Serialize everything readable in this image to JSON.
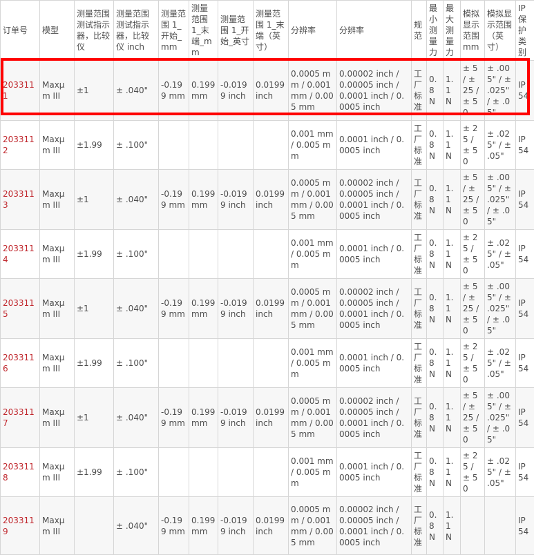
{
  "headers": [
    "订单号",
    "模型",
    "测量范围测试指示器，比较仪",
    "测量范围测试指示器，比较仪 inch",
    "测量范围 1_开始_mm",
    "测量范围 1_末端_mm",
    "测量范围 1_开始_英寸",
    "测量范围 1_末端（英寸）",
    "分辨率",
    "分辨率",
    "规范",
    "最小测量力",
    "最大测量力",
    "模拟显示范围 mm",
    "模拟显示范围（英寸）",
    "IP 保护类别"
  ],
  "rows": [
    {
      "order": "2033111",
      "model": "Maxμm III",
      "range": "±1",
      "range_inch": "± .040\"",
      "start_mm": "-0.199 mm",
      "end_mm": "0.199 mm",
      "start_in": "-0.0199 inch",
      "end_in": "0.0199 inch",
      "res_mm": "0.0005 mm / 0.001 mm / 0.005 mm",
      "res_in": "0.00002 inch / 0.00005 inch / 0.0001 inch / 0.0005 inch",
      "spec": "工厂标准",
      "min_force": "0.8 N",
      "max_force": "1.1 N",
      "analog_mm": "± 5 / ± 25 / ± 50",
      "analog_in": "± .005\" / ± .025\" / ± .05\"",
      "ip": "IP 54"
    },
    {
      "order": "2033112",
      "model": "Maxμm III",
      "range": "±1.99",
      "range_inch": "± .100\"",
      "start_mm": "",
      "end_mm": "",
      "start_in": "",
      "end_in": "",
      "res_mm": "0.001 mm / 0.005 mm",
      "res_in": "0.0001 inch / 0.0005 inch",
      "spec": "工厂标准",
      "min_force": "0.8 N",
      "max_force": "1.1 N",
      "analog_mm": "± 25 / ± 50",
      "analog_in": "± .025\" / ± .05\"",
      "ip": "IP 54"
    },
    {
      "order": "2033113",
      "model": "Maxμm III",
      "range": "±1",
      "range_inch": "± .040\"",
      "start_mm": "-0.199 mm",
      "end_mm": "0.199 mm",
      "start_in": "-0.0199 inch",
      "end_in": "0.0199 inch",
      "res_mm": "0.0005 mm / 0.001 mm / 0.005 mm",
      "res_in": "0.00002 inch / 0.00005 inch / 0.0001 inch / 0.0005 inch",
      "spec": "工厂标准",
      "min_force": "0.8 N",
      "max_force": "1.1 N",
      "analog_mm": "± 5 / ± 25 / ± 50",
      "analog_in": "± .005\" / ± .025\" / ± .05\"",
      "ip": "IP 54"
    },
    {
      "order": "2033114",
      "model": "Maxμm III",
      "range": "±1.99",
      "range_inch": "± .100\"",
      "start_mm": "",
      "end_mm": "",
      "start_in": "",
      "end_in": "",
      "res_mm": "0.001 mm / 0.005 mm",
      "res_in": "0.0001 inch / 0.0005 inch",
      "spec": "工厂标准",
      "min_force": "0.8 N",
      "max_force": "1.1 N",
      "analog_mm": "± 25 / ± 50",
      "analog_in": "± .025\" / ± .05\"",
      "ip": "IP 54"
    },
    {
      "order": "2033115",
      "model": "Maxμm III",
      "range": "±1",
      "range_inch": "± .040\"",
      "start_mm": "-0.199 mm",
      "end_mm": "0.199 mm",
      "start_in": "-0.0199 inch",
      "end_in": "0.0199 inch",
      "res_mm": "0.0005 mm / 0.001 mm / 0.005 mm",
      "res_in": "0.00002 inch / 0.00005 inch / 0.0001 inch / 0.0005 inch",
      "spec": "工厂标准",
      "min_force": "0.8 N",
      "max_force": "1.1 N",
      "analog_mm": "± 5 / ± 25 / ± 50",
      "analog_in": "± .005\" / ± .025\" / ± .05\"",
      "ip": "IP 54"
    },
    {
      "order": "2033116",
      "model": "Maxμm III",
      "range": "±1.99",
      "range_inch": "± .100\"",
      "start_mm": "",
      "end_mm": "",
      "start_in": "",
      "end_in": "",
      "res_mm": "0.001 mm / 0.005 mm",
      "res_in": "0.0001 inch / 0.0005 inch",
      "spec": "工厂标准",
      "min_force": "0.8 N",
      "max_force": "1.1 N",
      "analog_mm": "± 25 / ± 50",
      "analog_in": "± .025\" / ± .05\"",
      "ip": "IP 54"
    },
    {
      "order": "2033117",
      "model": "Maxμm III",
      "range": "±1",
      "range_inch": "± .040\"",
      "start_mm": "-0.199 mm",
      "end_mm": "0.199 mm",
      "start_in": "-0.0199 inch",
      "end_in": "0.0199 inch",
      "res_mm": "0.0005 mm / 0.001 mm / 0.005 mm",
      "res_in": "0.00002 inch / 0.00005 inch / 0.0001 inch / 0.0005 inch",
      "spec": "工厂标准",
      "min_force": "0.8 N",
      "max_force": "1.1 N",
      "analog_mm": "± 5 / ± 25 / ± 50",
      "analog_in": "± .005\" / ± .025\" / ± .05\"",
      "ip": "IP 54"
    },
    {
      "order": "2033118",
      "model": "Maxμm III",
      "range": "±1.99",
      "range_inch": "± .100\"",
      "start_mm": "",
      "end_mm": "",
      "start_in": "",
      "end_in": "",
      "res_mm": "0.001 mm / 0.005 mm",
      "res_in": "0.0001 inch / 0.0005 inch",
      "spec": "工厂标准",
      "min_force": "0.8 N",
      "max_force": "1.1 N",
      "analog_mm": "± 25 / ± 50",
      "analog_in": "± .025\" / ± .05\"",
      "ip": "IP 54"
    },
    {
      "order": "2033119",
      "model": "Maxμm III",
      "range": "",
      "range_inch": "± .040\"",
      "start_mm": "-0.199 mm",
      "end_mm": "0.199 mm",
      "start_in": "-0.0199 inch",
      "end_in": "0.0199 inch",
      "res_mm": "0.0005 mm / 0.001 mm / 0.005 mm",
      "res_in": "0.00002 inch / 0.00005 inch / 0.0001 inch / 0.0005 inch",
      "spec": "工厂标准",
      "min_force": "0.8 N",
      "max_force": "1.1 N",
      "analog_mm": "",
      "analog_in": "",
      "ip": "IP 54"
    }
  ],
  "colors": {
    "order_link": "#c0272d",
    "highlight": "#ff0000",
    "border": "#d6d6d6",
    "row_alt": "#f7f7f7",
    "text": "#4d4d4d"
  }
}
